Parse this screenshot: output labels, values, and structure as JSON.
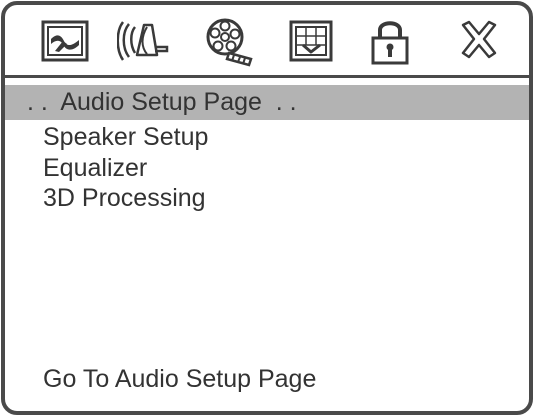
{
  "toolbar": {
    "icons": [
      "general-setup-icon",
      "audio-speaker-icon",
      "video-reel-icon",
      "preference-screen-icon",
      "password-lock-icon",
      "exit-icon"
    ]
  },
  "page": {
    "title": ". .  Audio Setup Page  . ."
  },
  "menu": {
    "items": [
      {
        "label": "Speaker Setup"
      },
      {
        "label": "Equalizer"
      },
      {
        "label": "3D Processing"
      }
    ]
  },
  "status": {
    "text": "Go To Audio Setup Page"
  },
  "colors": {
    "border": "#4a4a4a",
    "highlight": "#b3b3b3",
    "text": "#333333"
  }
}
